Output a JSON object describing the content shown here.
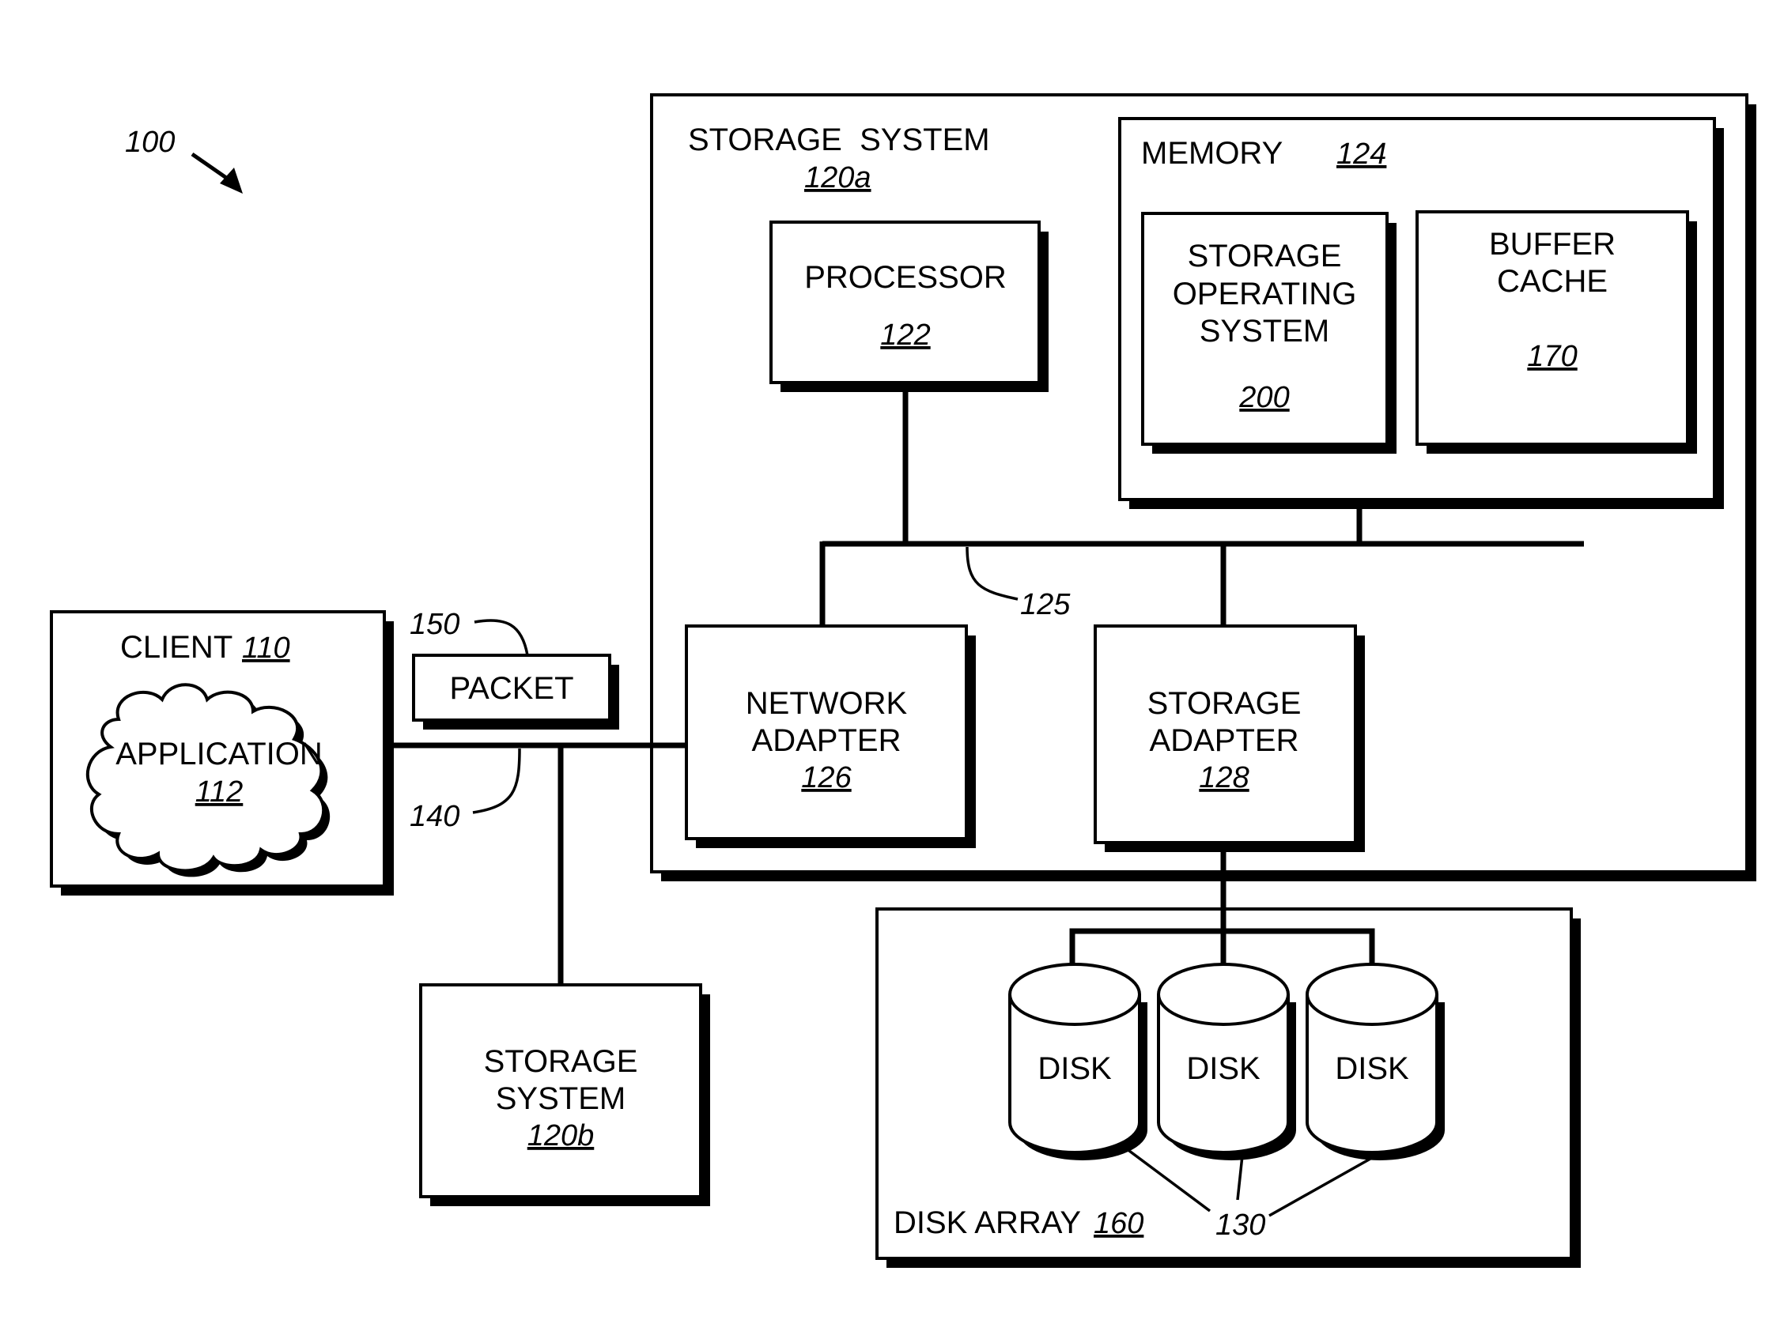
{
  "figure": {
    "ref": "100"
  },
  "storage_system_a": {
    "title": "STORAGE  SYSTEM",
    "ref": "120a",
    "processor": {
      "label": "PROCESSOR",
      "ref": "122"
    },
    "memory": {
      "label": "MEMORY",
      "ref": "124",
      "storage_os": {
        "lines": [
          "STORAGE",
          "OPERATING",
          "SYSTEM"
        ],
        "ref": "200"
      },
      "buffer_cache": {
        "lines": [
          "BUFFER",
          "CACHE"
        ],
        "ref": "170"
      }
    },
    "bus": {
      "ref": "125"
    },
    "network_adapter": {
      "lines": [
        "NETWORK",
        "ADAPTER"
      ],
      "ref": "126"
    },
    "storage_adapter": {
      "lines": [
        "STORAGE",
        "ADAPTER"
      ],
      "ref": "128"
    }
  },
  "client": {
    "label": "CLIENT",
    "ref": "110",
    "application": {
      "label": "APPLICATION",
      "ref": "112"
    }
  },
  "packet": {
    "label": "PACKET",
    "ref": "150"
  },
  "network": {
    "ref": "140"
  },
  "storage_system_b": {
    "lines": [
      "STORAGE",
      "SYSTEM"
    ],
    "ref": "120b"
  },
  "disk_array": {
    "label": "DISK ARRAY",
    "ref": "160",
    "disks": [
      {
        "label": "DISK"
      },
      {
        "label": "DISK"
      },
      {
        "label": "DISK"
      }
    ],
    "disks_ref": "130"
  }
}
